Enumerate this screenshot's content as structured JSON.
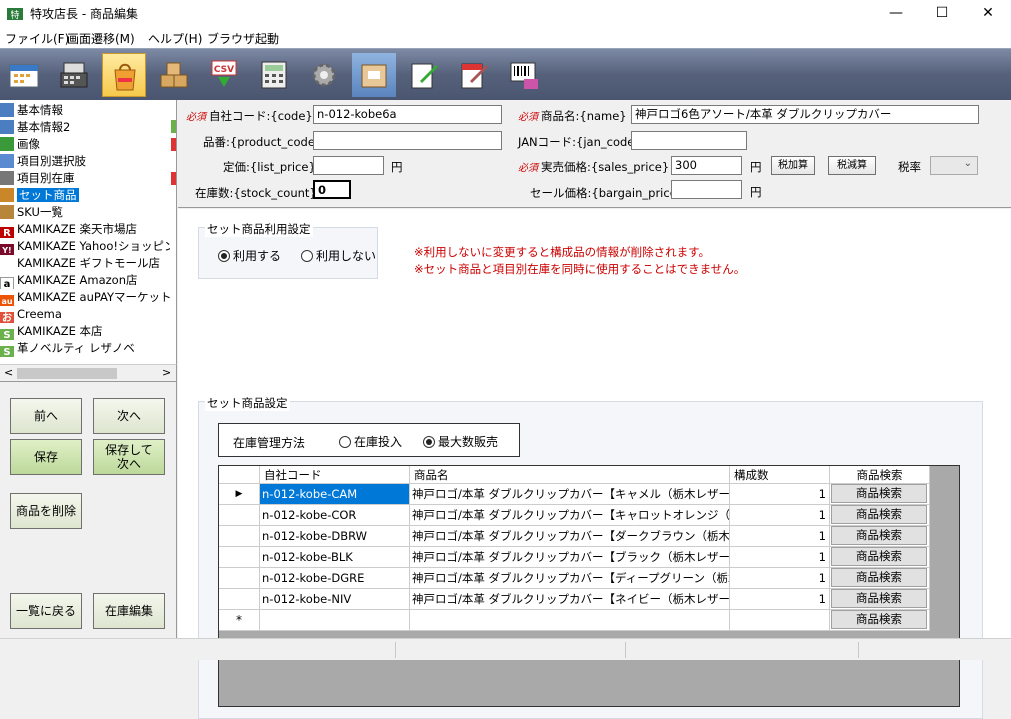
{
  "window": {
    "title": "特攻店長 - 商品編集",
    "minimize": "—",
    "maximize": "☐",
    "close": "✕"
  },
  "menu": [
    "ファイル(F)",
    "画面遷移(M)",
    "ヘルプ(H)",
    "ブラウザ起動"
  ],
  "toolbar": [
    "calendar-icon",
    "register-icon",
    "shopping-bag-icon",
    "boxes-icon",
    "csv-download-icon",
    "calculator-icon",
    "gear-icon",
    "label-box-icon",
    "edit-sheet-icon",
    "edit-sheet2-icon",
    "barcode-icon"
  ],
  "sidebar": {
    "items": [
      {
        "label": "基本情報",
        "icon": "form-icon"
      },
      {
        "label": "基本情報2",
        "icon": "form-icon"
      },
      {
        "label": "画像",
        "icon": "image-icon"
      },
      {
        "label": "項目別選択肢",
        "icon": "checklist-icon"
      },
      {
        "label": "項目別在庫",
        "icon": "grid-icon"
      },
      {
        "label": "セット商品",
        "icon": "set-icon"
      },
      {
        "label": "SKU一覧",
        "icon": "sku-icon"
      },
      {
        "label": "KAMIKAZE 楽天市場店",
        "icon": "R"
      },
      {
        "label": "KAMIKAZE Yahoo!ショッピン…",
        "icon": "Y!"
      },
      {
        "label": "KAMIKAZE ギフトモール店",
        "icon": ""
      },
      {
        "label": "KAMIKAZE Amazon店",
        "icon": "a"
      },
      {
        "label": "KAMIKAZE auPAYマーケット…",
        "icon": "au"
      },
      {
        "label": "Creema",
        "icon": "お"
      },
      {
        "label": "KAMIKAZE 本店",
        "icon": "S"
      },
      {
        "label": "革ノベルティ レザノベ",
        "icon": "S"
      }
    ],
    "scroll_left": "<",
    "scroll_right": ">"
  },
  "buttons": {
    "prev": "前へ",
    "next": "次へ",
    "save": "保存",
    "save_next_1": "保存して",
    "save_next_2": "次へ",
    "delete": "商品を削除",
    "back_list": "一覧に戻る",
    "stock_edit": "在庫編集"
  },
  "form": {
    "required": "必須",
    "code_label": "自社コード:{code}",
    "code_value": "n-012-kobe6a",
    "name_label": "商品名:{name}",
    "name_value": "神戸ロゴ6色アソート/本革 ダブルクリップカバー",
    "product_code_label": "品番:{product_code}",
    "product_code_value": "",
    "jan_label": "JANコード:{jan_code}",
    "jan_value": "",
    "list_price_label": "定価:{list_price}",
    "list_price_value": "",
    "yen": "円",
    "sales_price_label": "実売価格:{sales_price}",
    "sales_price_value": "300",
    "tax_add": "税加算",
    "tax_sub": "税減算",
    "tax_rate_label": "税率",
    "stock_label": "在庫数:{stock_count}",
    "stock_value": "0",
    "bargain_label": "セール価格:{bargain_price}",
    "bargain_value": ""
  },
  "set_usage": {
    "title": "セット商品利用設定",
    "use": "利用する",
    "nouse": "利用しない",
    "warn1": "※利用しないに変更すると構成品の情報が削除されます。",
    "warn2": "※セット商品と項目別在庫を同時に使用することはできません。"
  },
  "set_settings": {
    "title": "セット商品設定",
    "stock_mode_label": "在庫管理方法",
    "mode_stock": "在庫投入",
    "mode_max": "最大数販売"
  },
  "grid": {
    "headers": {
      "code": "自社コード",
      "name": "商品名",
      "qty": "構成数",
      "search": "商品検索"
    },
    "rows": [
      {
        "code": "n-012-kobe-CAM",
        "name": "神戸ロゴ/本革 ダブルクリップカバー【キャメル（栃木レザー）】",
        "qty": "1",
        "search": "商品検索"
      },
      {
        "code": "n-012-kobe-COR",
        "name": "神戸ロゴ/本革 ダブルクリップカバー【キャロットオレンジ（栃木レザー…",
        "qty": "1",
        "search": "商品検索"
      },
      {
        "code": "n-012-kobe-DBRW",
        "name": "神戸ロゴ/本革 ダブルクリップカバー【ダークブラウン（栃木レザー）】",
        "qty": "1",
        "search": "商品検索"
      },
      {
        "code": "n-012-kobe-BLK",
        "name": "神戸ロゴ/本革 ダブルクリップカバー【ブラック（栃木レザー）】",
        "qty": "1",
        "search": "商品検索"
      },
      {
        "code": "n-012-kobe-DGRE",
        "name": "神戸ロゴ/本革 ダブルクリップカバー【ディープグリーン（栃木レザー）】",
        "qty": "1",
        "search": "商品検索"
      },
      {
        "code": "n-012-kobe-NIV",
        "name": "神戸ロゴ/本革 ダブルクリップカバー【ネイビー（栃木レザー）】",
        "qty": "1",
        "search": "商品検索"
      }
    ],
    "new_row_search": "商品検索",
    "current_marker": "▶",
    "new_marker": "*"
  },
  "colors": {
    "accent": "#0078d7",
    "required": "#cc0000",
    "toolbar": "#56617b"
  }
}
